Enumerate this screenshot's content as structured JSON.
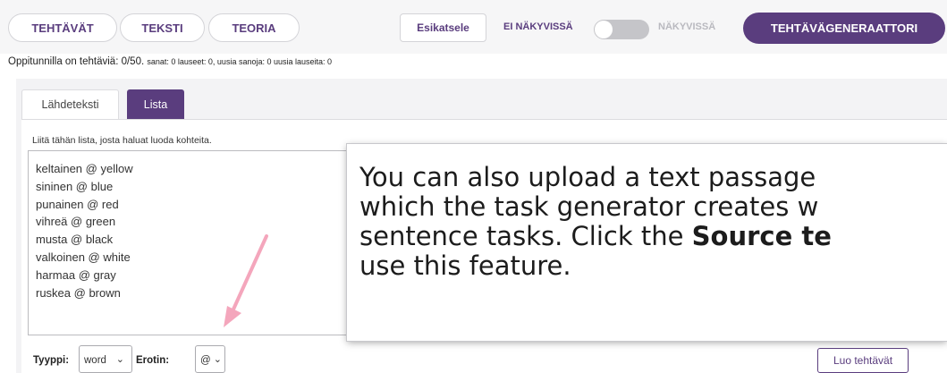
{
  "nav": {
    "tabs": [
      {
        "label": "TEHTÄVÄT"
      },
      {
        "label": "TEKSTI"
      },
      {
        "label": "TEORIA"
      }
    ],
    "preview_label": "Esikatsele",
    "visibility": {
      "off_label": "EI NÄKYVISSÄ",
      "on_label": "NÄKYVISSÄ",
      "state": "off"
    },
    "generator_label": "TEHTÄVÄGENERAATTORI"
  },
  "counts": {
    "main": "Oppitunnilla on tehtäviä: 0/50.",
    "detail": "sanat: 0 lauseet: 0, uusia sanoja: 0 uusia lauseita: 0"
  },
  "editor": {
    "tabs": [
      {
        "label": "Lähdeteksti",
        "active": false
      },
      {
        "label": "Lista",
        "active": true
      }
    ],
    "instruction": "Liitä tähän lista, josta haluat luoda kohteita.",
    "lines": [
      "keltainen @ yellow",
      "sininen @ blue",
      "punainen @ red",
      "vihreä @ green",
      "musta @ black",
      "valkoinen @ white",
      "harmaa @ gray",
      "ruskea @ brown"
    ]
  },
  "tooltip": {
    "line1": "You can also upload a text passage",
    "line2": "which the task generator creates w",
    "line3_before": "sentence tasks. Click the ",
    "line3_bold": "Source te",
    "line4": "use this feature."
  },
  "controls": {
    "type_label": "Tyyppi:",
    "type_value": "word",
    "separator_label": "Erotin:",
    "separator_value": "@",
    "create_label": "Luo tehtävät"
  },
  "colors": {
    "brand_purple": "#5a3d7e",
    "arrow_pink": "#f4a6bc"
  },
  "icons": {
    "annotation_arrow": "arrow-down-left",
    "dropdown": "chevron-down"
  }
}
